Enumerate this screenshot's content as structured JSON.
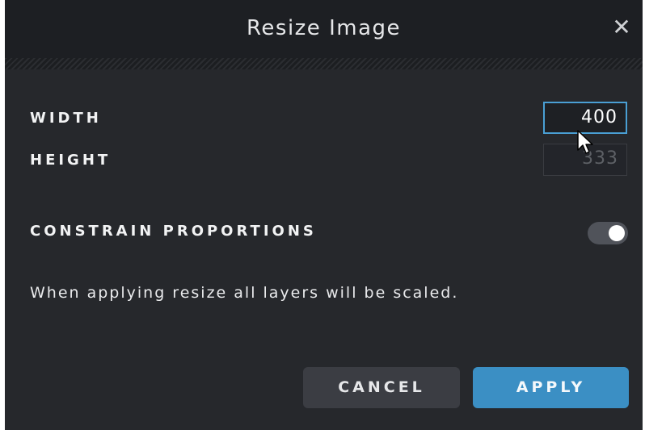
{
  "dialog": {
    "title": "Resize Image",
    "close_icon": "close-icon"
  },
  "fields": {
    "width_label": "WIDTH",
    "width_value": "400",
    "height_label": "HEIGHT",
    "height_value": "333"
  },
  "constrain": {
    "label": "CONSTRAIN PROPORTIONS",
    "enabled": true
  },
  "note": "When applying resize all layers will be scaled.",
  "buttons": {
    "cancel": "CANCEL",
    "apply": "APPLY"
  },
  "colors": {
    "accent": "#3b8fc4",
    "background": "#26282c",
    "header": "#1d1f23"
  },
  "cursor_icon": "mouse-pointer-icon"
}
